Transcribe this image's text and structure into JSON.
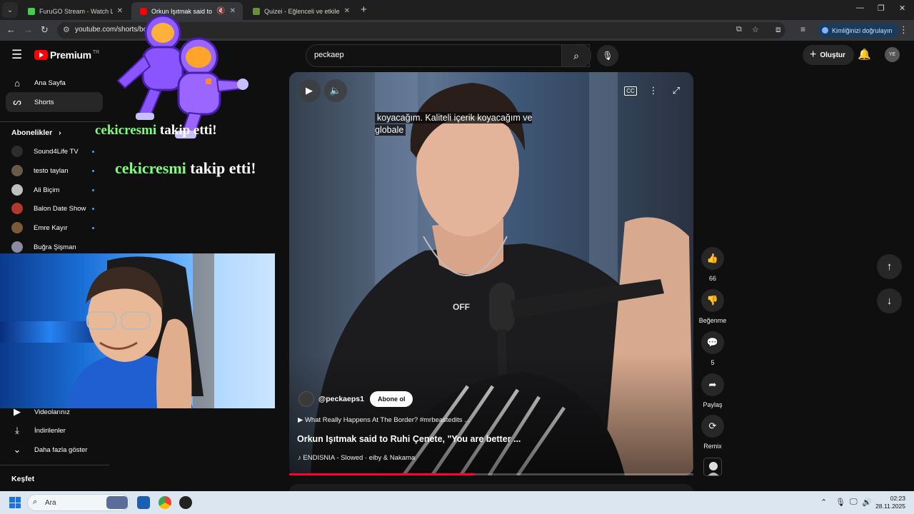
{
  "browser": {
    "tabs": [
      {
        "title": "FuruGO Stream - Watch Live o...",
        "favicon_color": "#3cd24b",
        "active": false
      },
      {
        "title": "Orkun Işıtmak said to Ruhi ...",
        "favicon_color": "#ff0000",
        "active": true
      },
      {
        "title": "Quizei - Eğlenceli ve etkileşimli...",
        "favicon_color": "#6a8f3a",
        "active": false
      }
    ],
    "url": "youtube.com/shorts/bo",
    "verify_label": "Kimliğinizi doğrulayın"
  },
  "masthead": {
    "logo_text": "Premium",
    "country": "TR",
    "search_query": "peckaep",
    "create_label": "Oluştur",
    "avatar_initials": "YE"
  },
  "sidebar": {
    "nav": [
      {
        "label": "Ana Sayfa",
        "icon": "home-icon"
      },
      {
        "label": "Shorts",
        "icon": "shorts-icon"
      }
    ],
    "subscriptions_title": "Abonelikler",
    "subscriptions": [
      {
        "name": "Sound4Life TV",
        "color": "#2d2d2d"
      },
      {
        "name": "testo taylan",
        "color": "#6a5a4a"
      },
      {
        "name": "Ali Biçim",
        "color": "#bfbfbf"
      },
      {
        "name": "Balon Date Show",
        "color": "#b03a2e"
      },
      {
        "name": "Emre Kayır",
        "color": "#7a5a3a"
      },
      {
        "name": "Buğra Şişman",
        "color": "#8a8aa0"
      }
    ],
    "you_items": [
      {
        "label": "Videolarınız",
        "icon": "video-icon"
      },
      {
        "label": "İndirilenler",
        "icon": "download-icon"
      },
      {
        "label": "Daha fazla göster",
        "icon": "chevron-down-icon"
      }
    ],
    "explore_title": "Keşfet"
  },
  "overlay": {
    "follower_name": "cekicresmi",
    "follow_text": "takip etti!"
  },
  "video": {
    "caption": "koyacağım. Kaliteli içerik koyacağım ve globale",
    "shirt_text": "OFF",
    "channel": "@peckaeps1",
    "subscribe_label": "Abone ol",
    "related": "What Really Happens At The Border? #mrbeastedits ...",
    "title": "Orkun Işıtmak said to Ruhi Çenete, \"You are better ...",
    "music": "ENDISNIA - Slowed · eiby & Nakama",
    "progress": 0.46
  },
  "actions": {
    "like_count": "66",
    "dislike_label": "Beğenme",
    "comment_count": "5",
    "share_label": "Paylaş",
    "remix_label": "Remix"
  },
  "taskbar": {
    "search_placeholder": "Ara",
    "time": "02:23",
    "date": "28.11.2025"
  }
}
